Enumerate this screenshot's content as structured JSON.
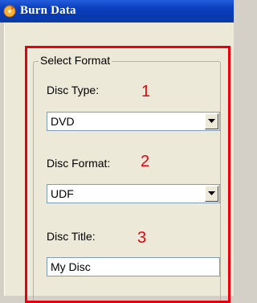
{
  "window": {
    "title": "Burn Data",
    "icon": "burn-disc-icon"
  },
  "group": {
    "legend": "Select Format"
  },
  "fields": {
    "disc_type": {
      "label": "Disc Type:",
      "value": "DVD",
      "marker": "1"
    },
    "disc_format": {
      "label": "Disc Format:",
      "value": "UDF",
      "marker": "2"
    },
    "disc_title": {
      "label": "Disc Title:",
      "value": "My Disc",
      "marker": "3"
    }
  },
  "colors": {
    "annotation": "#e8000e",
    "titlebar": "#0a3fbf",
    "panel": "#ece9d8"
  }
}
